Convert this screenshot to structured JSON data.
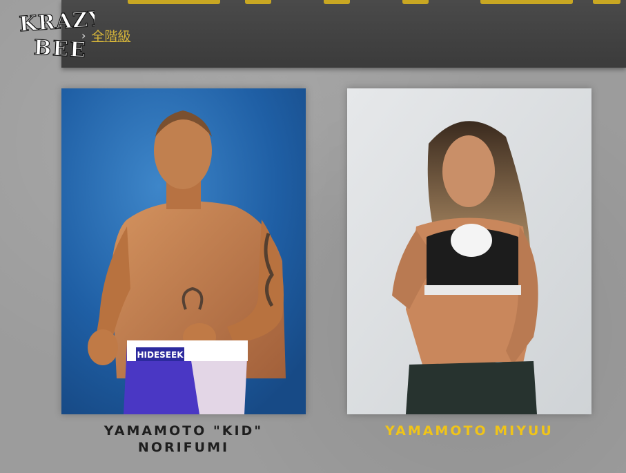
{
  "header": {
    "logo_text": "KRAZY BEE",
    "breadcrumb": {
      "separator": "›",
      "current": "全階級"
    },
    "accent_color": "#c9a722"
  },
  "fighters": [
    {
      "name": "YAMAMOTO \"KID\" NORIFUMI",
      "trunks_text": "HIDESEEK",
      "name_color": "#1e1e1e"
    },
    {
      "name": "YAMAMOTO MIYUU",
      "name_color": "#f0c419",
      "highlighted": true
    }
  ]
}
